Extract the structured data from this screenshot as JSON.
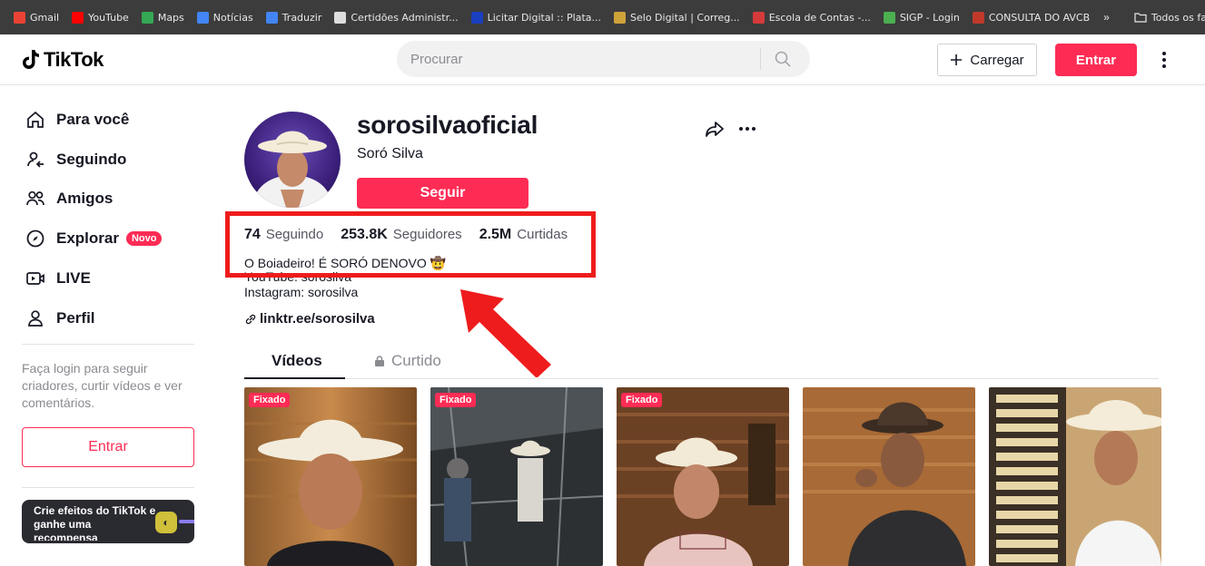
{
  "bookmarks": [
    {
      "label": "Gmail",
      "color": "#ea4335"
    },
    {
      "label": "YouTube",
      "color": "#ff0000"
    },
    {
      "label": "Maps",
      "color": "#34a853"
    },
    {
      "label": "Notícias",
      "color": "#4285f4"
    },
    {
      "label": "Traduzir",
      "color": "#4285f4"
    },
    {
      "label": "Certidões Administr...",
      "color": "#dddddd"
    },
    {
      "label": "Licitar Digital :: Plata...",
      "color": "#1a3fbf"
    },
    {
      "label": "Selo Digital | Correg...",
      "color": "#cfa23a"
    },
    {
      "label": "Escola de Contas -...",
      "color": "#d43a3a"
    },
    {
      "label": "SIGP - Login",
      "color": "#4caf50"
    },
    {
      "label": "CONSULTA DO AVCB",
      "color": "#c0392b"
    }
  ],
  "bookmarks_more": "»",
  "bookmarks_all": "Todos os favoritos",
  "header": {
    "logo": "TikTok",
    "search_placeholder": "Procurar",
    "upload_label": "Carregar",
    "login_label": "Entrar"
  },
  "sidebar": {
    "items": [
      {
        "label": "Para você",
        "icon": "home-icon"
      },
      {
        "label": "Seguindo",
        "icon": "following-icon"
      },
      {
        "label": "Amigos",
        "icon": "friends-icon"
      },
      {
        "label": "Explorar",
        "icon": "compass-icon",
        "badge": "Novo"
      },
      {
        "label": "LIVE",
        "icon": "live-icon"
      },
      {
        "label": "Perfil",
        "icon": "profile-icon"
      }
    ],
    "login_hint": "Faça login para seguir criadores, curtir vídeos e ver comentários.",
    "login_button": "Entrar",
    "effects_banner": "Crie efeitos do TikTok e ganhe uma recompensa"
  },
  "profile": {
    "username": "sorosilvaoficial",
    "nickname": "Soró Silva",
    "follow_label": "Seguir",
    "stats": [
      {
        "value": "74",
        "label": "Seguindo"
      },
      {
        "value": "253.8K",
        "label": "Seguidores"
      },
      {
        "value": "2.5M",
        "label": "Curtidas"
      }
    ],
    "bio": [
      "O Boiadeiro! É SORÓ DENOVO 🤠",
      "YouTube: sorosilva",
      "Instagram: sorosilva"
    ],
    "link": "linktr.ee/sorosilva"
  },
  "tabs": {
    "videos": "Vídeos",
    "liked": "Curtido"
  },
  "videos": [
    {
      "pinned": "Fixado"
    },
    {
      "pinned": "Fixado"
    },
    {
      "pinned": "Fixado"
    },
    {
      "pinned": ""
    },
    {
      "pinned": ""
    }
  ],
  "colors": {
    "accent": "#fe2c55",
    "annotation": "#ee1c1c"
  }
}
